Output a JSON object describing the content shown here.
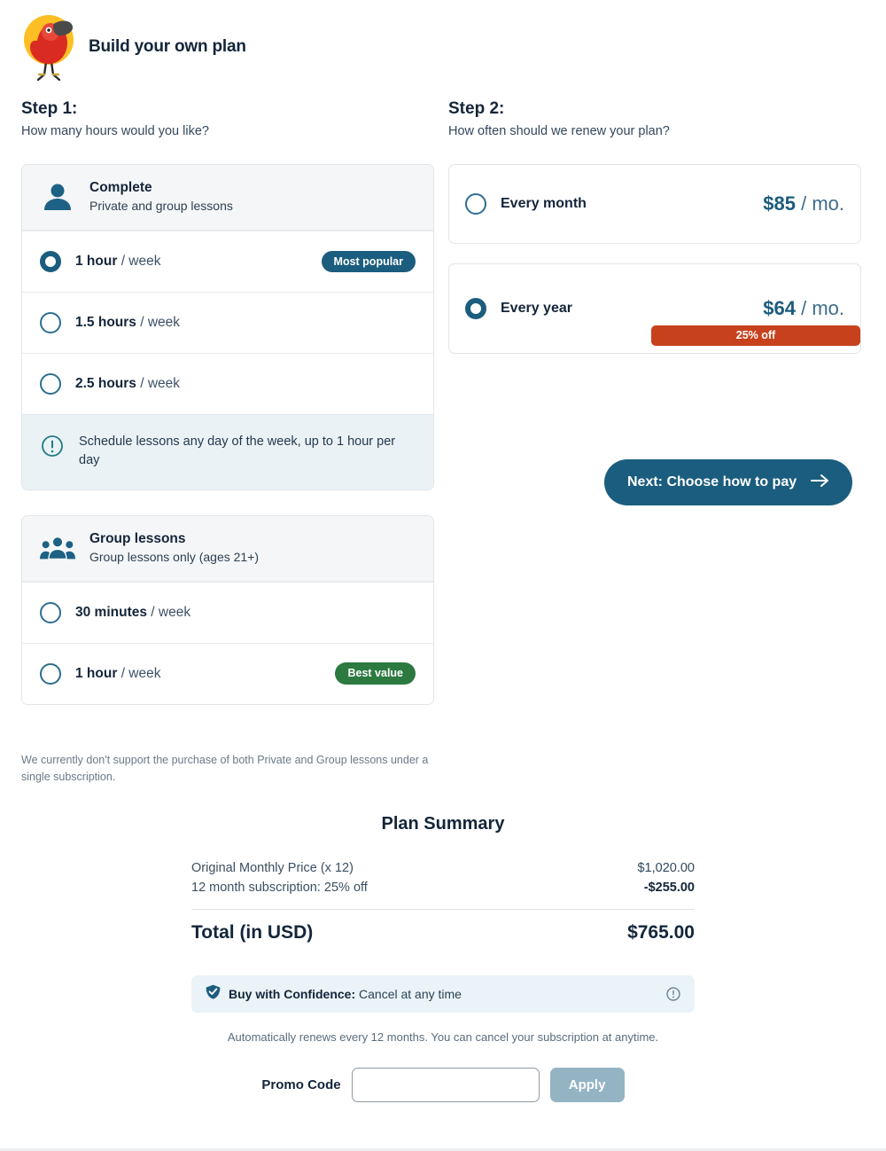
{
  "header": {
    "title": "Build your own plan",
    "logo_icon": "bird-logo-icon"
  },
  "step1": {
    "title": "Step 1:",
    "subtitle": "How many hours would you like?",
    "cards": [
      {
        "icon": "person-icon",
        "name": "Complete",
        "description": "Private and group lessons",
        "options": [
          {
            "amount": "1 hour",
            "period": "/ week",
            "selected": true,
            "badge": "Most popular",
            "badge_color": "#1b5d7e"
          },
          {
            "amount": "1.5 hours",
            "period": "/ week",
            "selected": false,
            "badge": "",
            "badge_color": ""
          },
          {
            "amount": "2.5 hours",
            "period": "/ week",
            "selected": false,
            "badge": "",
            "badge_color": ""
          }
        ],
        "note": "Schedule lessons any day of the week, up to 1 hour per day",
        "note_icon": "info-exclamation-icon"
      },
      {
        "icon": "group-people-icon",
        "name": "Group lessons",
        "description": "Group lessons only (ages 21+)",
        "options": [
          {
            "amount": "30 minutes",
            "period": "/ week",
            "selected": false,
            "badge": "",
            "badge_color": ""
          },
          {
            "amount": "1 hour",
            "period": "/ week",
            "selected": false,
            "badge": "Best value",
            "badge_color": "#2c7a3f"
          }
        ]
      }
    ],
    "footnote": "We currently don't support the purchase of both Private and Group lessons under a single subscription."
  },
  "step2": {
    "title": "Step 2:",
    "subtitle": "How often should we renew your plan?",
    "options": [
      {
        "label": "Every month",
        "price": "$85",
        "per": "/ mo.",
        "selected": false,
        "discount": ""
      },
      {
        "label": "Every year",
        "price": "$64",
        "per": "/ mo.",
        "selected": true,
        "discount": "25% off",
        "discount_color": "#c6411c"
      }
    ],
    "next_button": {
      "label": "Next: Choose how to pay",
      "icon": "arrow-right-icon"
    }
  },
  "summary": {
    "title": "Plan Summary",
    "rows": [
      {
        "label": "Original Monthly Price (x 12)",
        "value": "$1,020.00"
      },
      {
        "label": "12 month subscription: 25% off",
        "value": "-$255.00"
      }
    ],
    "total_label": "Total (in USD)",
    "total_value": "$765.00",
    "confidence": {
      "icon": "check-shield-icon",
      "bold": "Buy with Confidence:",
      "rest": " Cancel at any time",
      "info_icon": "info-circle-icon"
    },
    "renew_note": "Automatically renews every 12 months. You can cancel your subscription at anytime.",
    "promo": {
      "label": "Promo Code",
      "value": "",
      "placeholder": "",
      "apply_label": "Apply"
    }
  }
}
